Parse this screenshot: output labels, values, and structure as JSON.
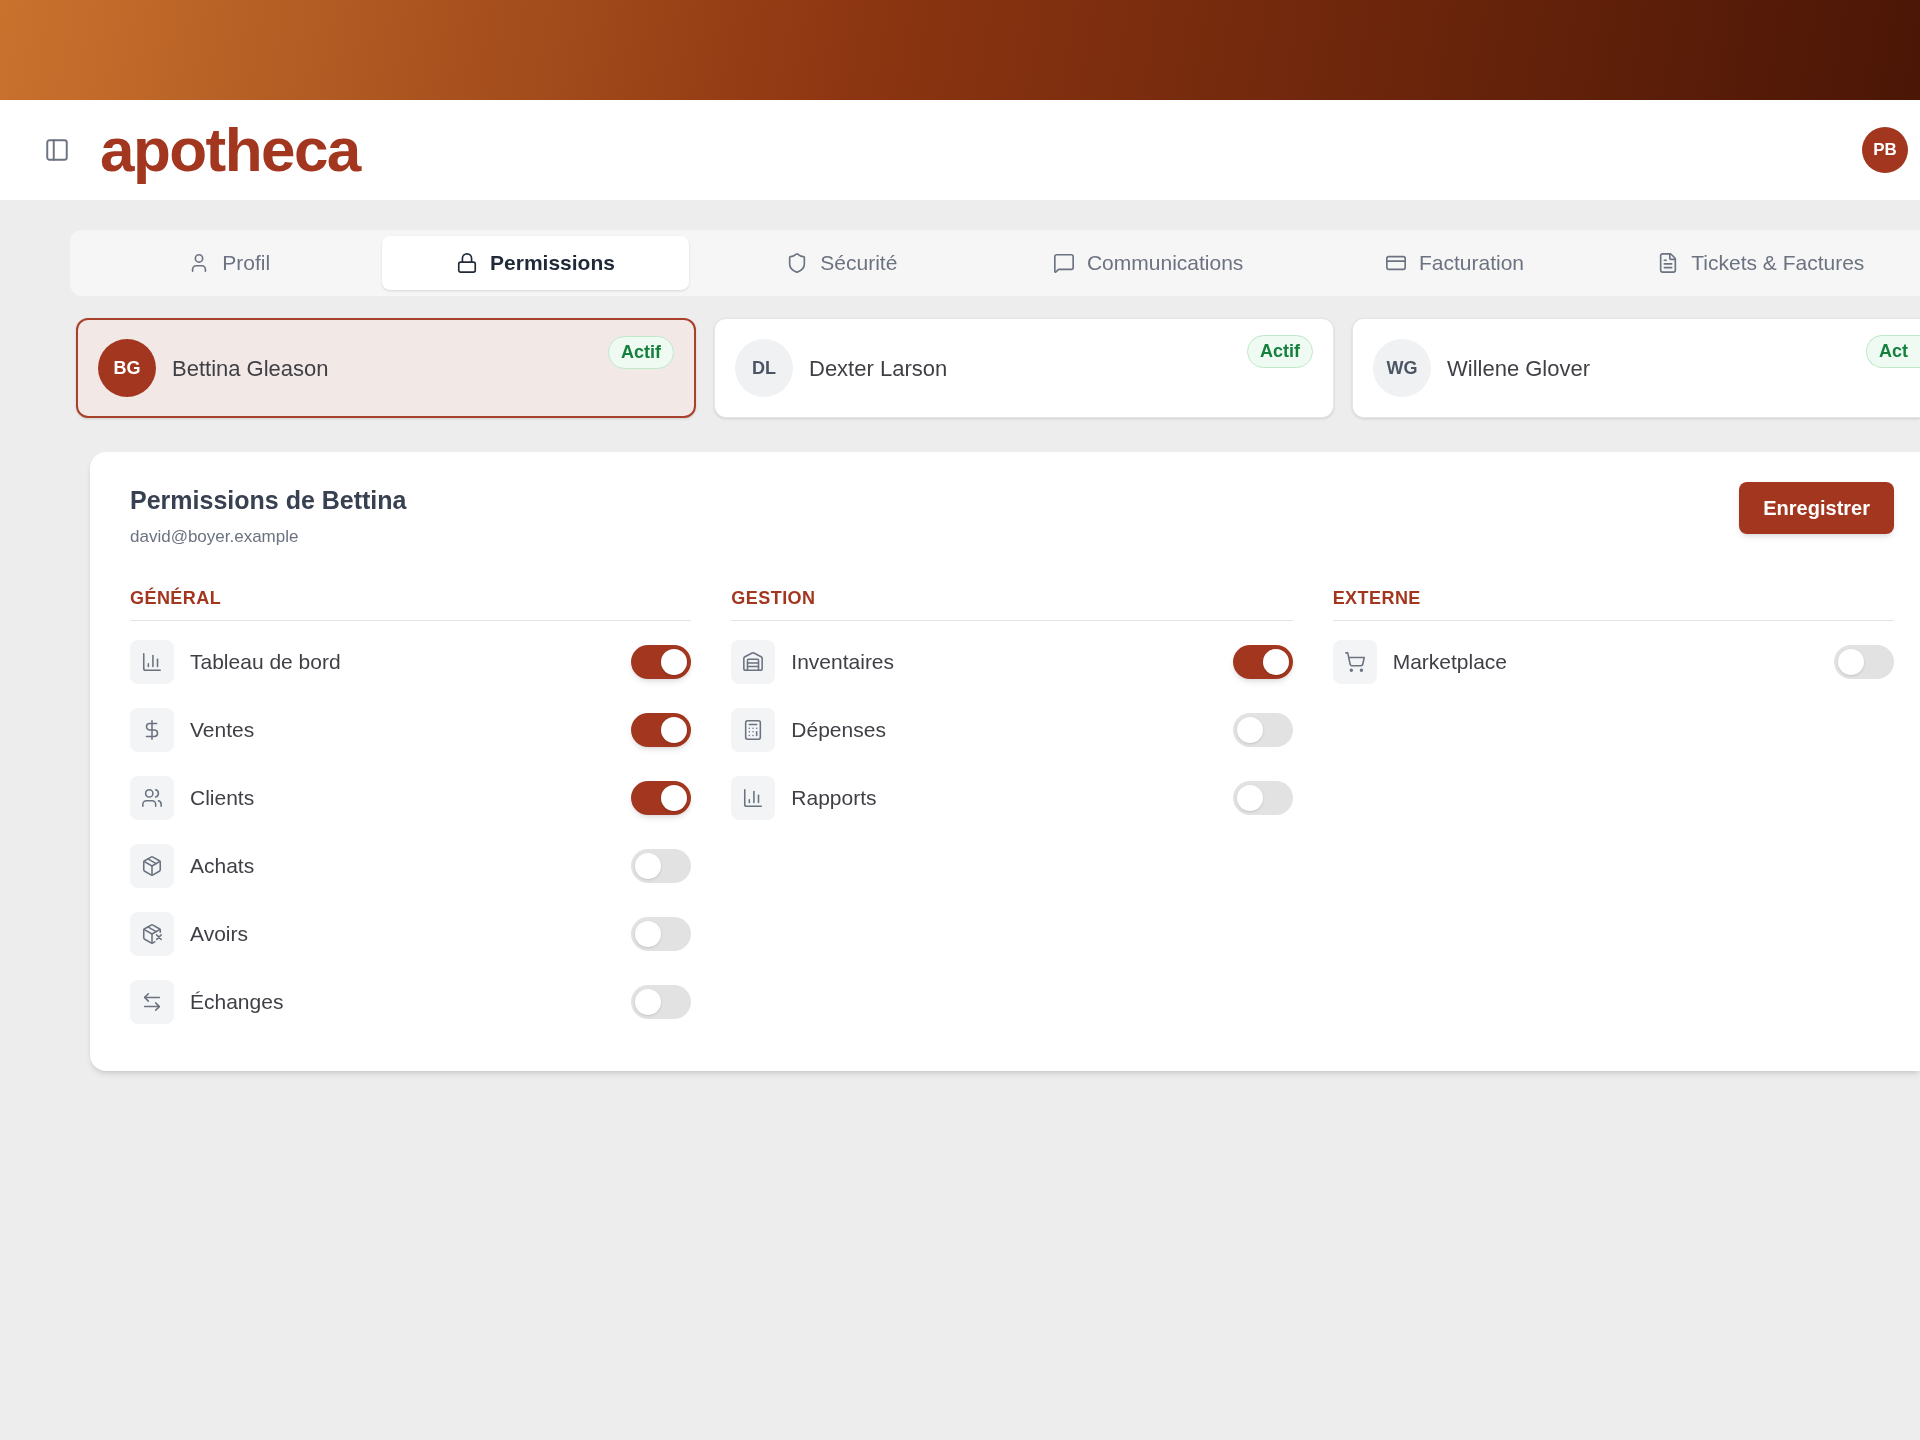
{
  "header": {
    "logo": "apotheca",
    "user_initials": "PB"
  },
  "tabs": [
    {
      "label": "Profil",
      "selected": false
    },
    {
      "label": "Permissions",
      "selected": true
    },
    {
      "label": "Sécurité",
      "selected": false
    },
    {
      "label": "Communications",
      "selected": false
    },
    {
      "label": "Facturation",
      "selected": false
    },
    {
      "label": "Tickets & Factures",
      "selected": false
    }
  ],
  "users": [
    {
      "initials": "BG",
      "name": "Bettina Gleason",
      "status": "Actif",
      "selected": true
    },
    {
      "initials": "DL",
      "name": "Dexter Larson",
      "status": "Actif",
      "selected": false
    },
    {
      "initials": "WG",
      "name": "Willene Glover",
      "status": "Act",
      "selected": false
    }
  ],
  "permissions": {
    "title": "Permissions de Bettina",
    "email": "david@boyer.example",
    "save_button": "Enregistrer",
    "groups": [
      {
        "title": "GÉNÉRAL",
        "items": [
          {
            "label": "Tableau de bord",
            "on": true
          },
          {
            "label": "Ventes",
            "on": true
          },
          {
            "label": "Clients",
            "on": true
          },
          {
            "label": "Achats",
            "on": false
          },
          {
            "label": "Avoirs",
            "on": false
          },
          {
            "label": "Échanges",
            "on": false
          }
        ]
      },
      {
        "title": "GESTION",
        "items": [
          {
            "label": "Inventaires",
            "on": true
          },
          {
            "label": "Dépenses",
            "on": false
          },
          {
            "label": "Rapports",
            "on": false
          }
        ]
      },
      {
        "title": "EXTERNE",
        "items": [
          {
            "label": "Marketplace",
            "on": false
          }
        ]
      }
    ]
  }
}
